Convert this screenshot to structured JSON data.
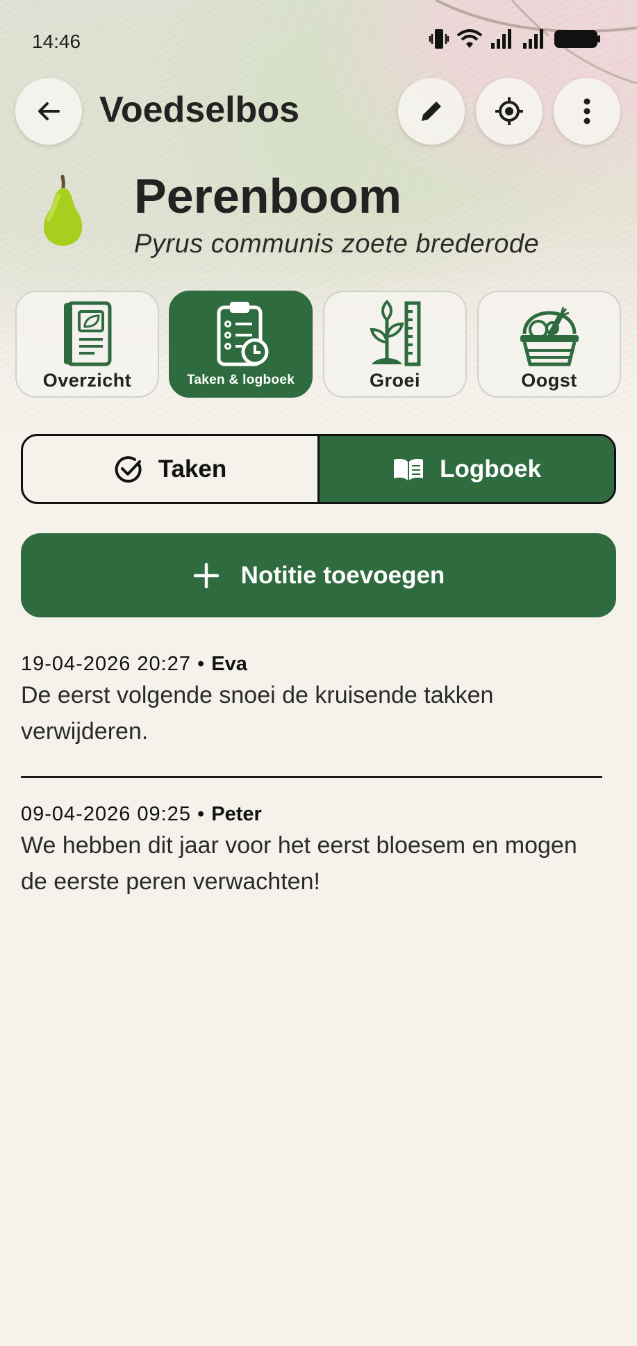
{
  "status_bar": {
    "time": "14:46"
  },
  "header": {
    "title": "Voedselbos",
    "back_icon": "arrow-left-icon",
    "actions": [
      "pencil-icon",
      "locate-icon",
      "more-vertical-icon"
    ]
  },
  "plant": {
    "icon": "pear-icon",
    "name": "Perenboom",
    "latin": "Pyrus communis zoete brederode"
  },
  "category_tabs": [
    {
      "label": "Overzicht",
      "icon": "notebook-leaf-icon",
      "active": false
    },
    {
      "label": "Taken & logboek",
      "icon": "clipboard-clock-icon",
      "active": true
    },
    {
      "label": "Groei",
      "icon": "sprout-ruler-icon",
      "active": false
    },
    {
      "label": "Oogst",
      "icon": "harvest-basket-icon",
      "active": false
    }
  ],
  "segments": {
    "tasks_label": "Taken",
    "log_label": "Logboek",
    "selected": "Logboek"
  },
  "add_note": {
    "label": "Notitie toevoegen"
  },
  "log_entries": [
    {
      "datetime": "19-04-2026 20:27",
      "separator": "•",
      "author": "Eva",
      "text": "De eerst volgende snoei de kruisende takken verwijderen."
    },
    {
      "datetime": "09-04-2026 09:25",
      "separator": "•",
      "author": "Peter",
      "text": "We hebben dit jaar voor het eerst bloesem en mogen de eerste peren verwachten!"
    }
  ],
  "colors": {
    "accent": "#2e6b3e",
    "background": "#f5f2ec",
    "text": "#1d1d1d"
  }
}
